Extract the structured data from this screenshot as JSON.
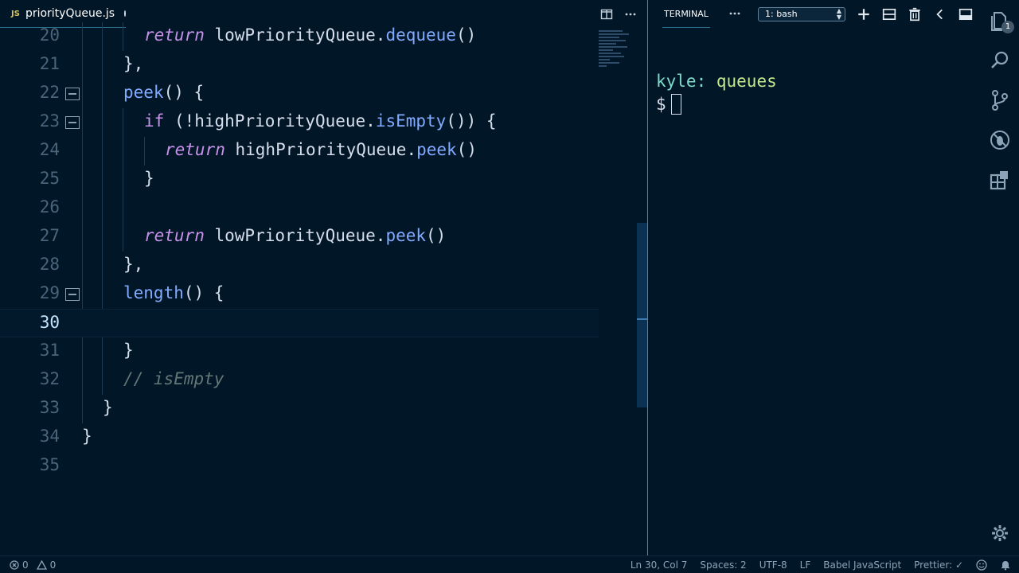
{
  "editor": {
    "tab": {
      "lang_badge": "JS",
      "filename": "priorityQueue.js"
    },
    "line_numbers": [
      "20",
      "21",
      "22",
      "23",
      "24",
      "25",
      "26",
      "27",
      "28",
      "29",
      "30",
      "31",
      "32",
      "33",
      "34",
      "35"
    ],
    "lines": {
      "l20": {
        "kw": "return",
        "obj": " lowPriorityQueue",
        "dot": ".",
        "fn": "dequeue",
        "rest": "()"
      },
      "l21": {
        "text": "},"
      },
      "l22": {
        "fn": "peek",
        "rest": "() {"
      },
      "l23": {
        "kw": "if",
        "p1": " (!",
        "obj": "highPriorityQueue",
        "dot": ".",
        "fn": "isEmpty",
        "rest": "()) {"
      },
      "l24": {
        "kw": "return",
        "obj": " highPriorityQueue",
        "dot": ".",
        "fn": "peek",
        "rest": "()"
      },
      "l25": {
        "text": "}"
      },
      "l27": {
        "kw": "return",
        "obj": " lowPriorityQueue",
        "dot": ".",
        "fn": "peek",
        "rest": "()"
      },
      "l28": {
        "text": "},"
      },
      "l29": {
        "fn": "length",
        "rest": "() {"
      },
      "l31": {
        "text": "}"
      },
      "l32": {
        "comment": "// isEmpty"
      },
      "l33": {
        "text": "}"
      },
      "l34": {
        "text": "}"
      }
    }
  },
  "terminal": {
    "tab_label": "TERMINAL",
    "shell_select": "1: bash",
    "user": "kyle:",
    "dir": "queues",
    "prompt": "$"
  },
  "activity": {
    "explorer_badge": "1"
  },
  "status": {
    "errors": "0",
    "warnings": "0",
    "position": "Ln 30, Col 7",
    "spaces": "Spaces: 2",
    "encoding": "UTF-8",
    "eol": "LF",
    "language": "Babel JavaScript",
    "formatter": "Prettier: ✓"
  },
  "colors": {
    "background": "#011627",
    "keyword": "#c792ea",
    "function": "#82aaff",
    "comment": "#637777",
    "terminal_user": "#7fdbca",
    "terminal_dir": "#c3e88d"
  },
  "icons": [
    "split-editor-icon",
    "more-icon",
    "add-terminal-icon",
    "split-terminal-icon",
    "trash-icon",
    "chevron-left-icon",
    "maximize-panel-icon",
    "explorer-icon",
    "search-icon",
    "source-control-icon",
    "debug-icon",
    "extensions-icon",
    "gear-icon",
    "error-icon",
    "warning-icon",
    "smiley-icon",
    "bell-icon"
  ]
}
